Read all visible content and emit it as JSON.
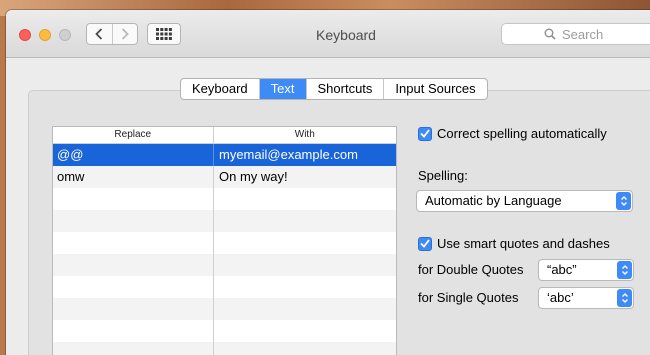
{
  "window": {
    "title": "Keyboard"
  },
  "search": {
    "placeholder": "Search"
  },
  "tabs": [
    {
      "label": "Keyboard"
    },
    {
      "label": "Text"
    },
    {
      "label": "Shortcuts"
    },
    {
      "label": "Input Sources"
    }
  ],
  "table": {
    "headers": {
      "replace": "Replace",
      "with": "With"
    },
    "rows": [
      {
        "replace": "@@",
        "with": "myemail@example.com"
      },
      {
        "replace": "omw",
        "with": "On my way!"
      }
    ]
  },
  "options": {
    "correct_spelling": {
      "label": "Correct spelling automatically",
      "checked": true
    },
    "spelling_label": "Spelling:",
    "spelling_value": "Automatic by Language",
    "smart_quotes": {
      "label": "Use smart quotes and dashes",
      "checked": true
    },
    "double_quotes_label": "for Double Quotes",
    "double_quotes_value": "“abc”",
    "single_quotes_label": "for Single Quotes",
    "single_quotes_value": "‘abc’"
  },
  "colors": {
    "accent": "#3e8bf7",
    "selection": "#1864d8"
  }
}
